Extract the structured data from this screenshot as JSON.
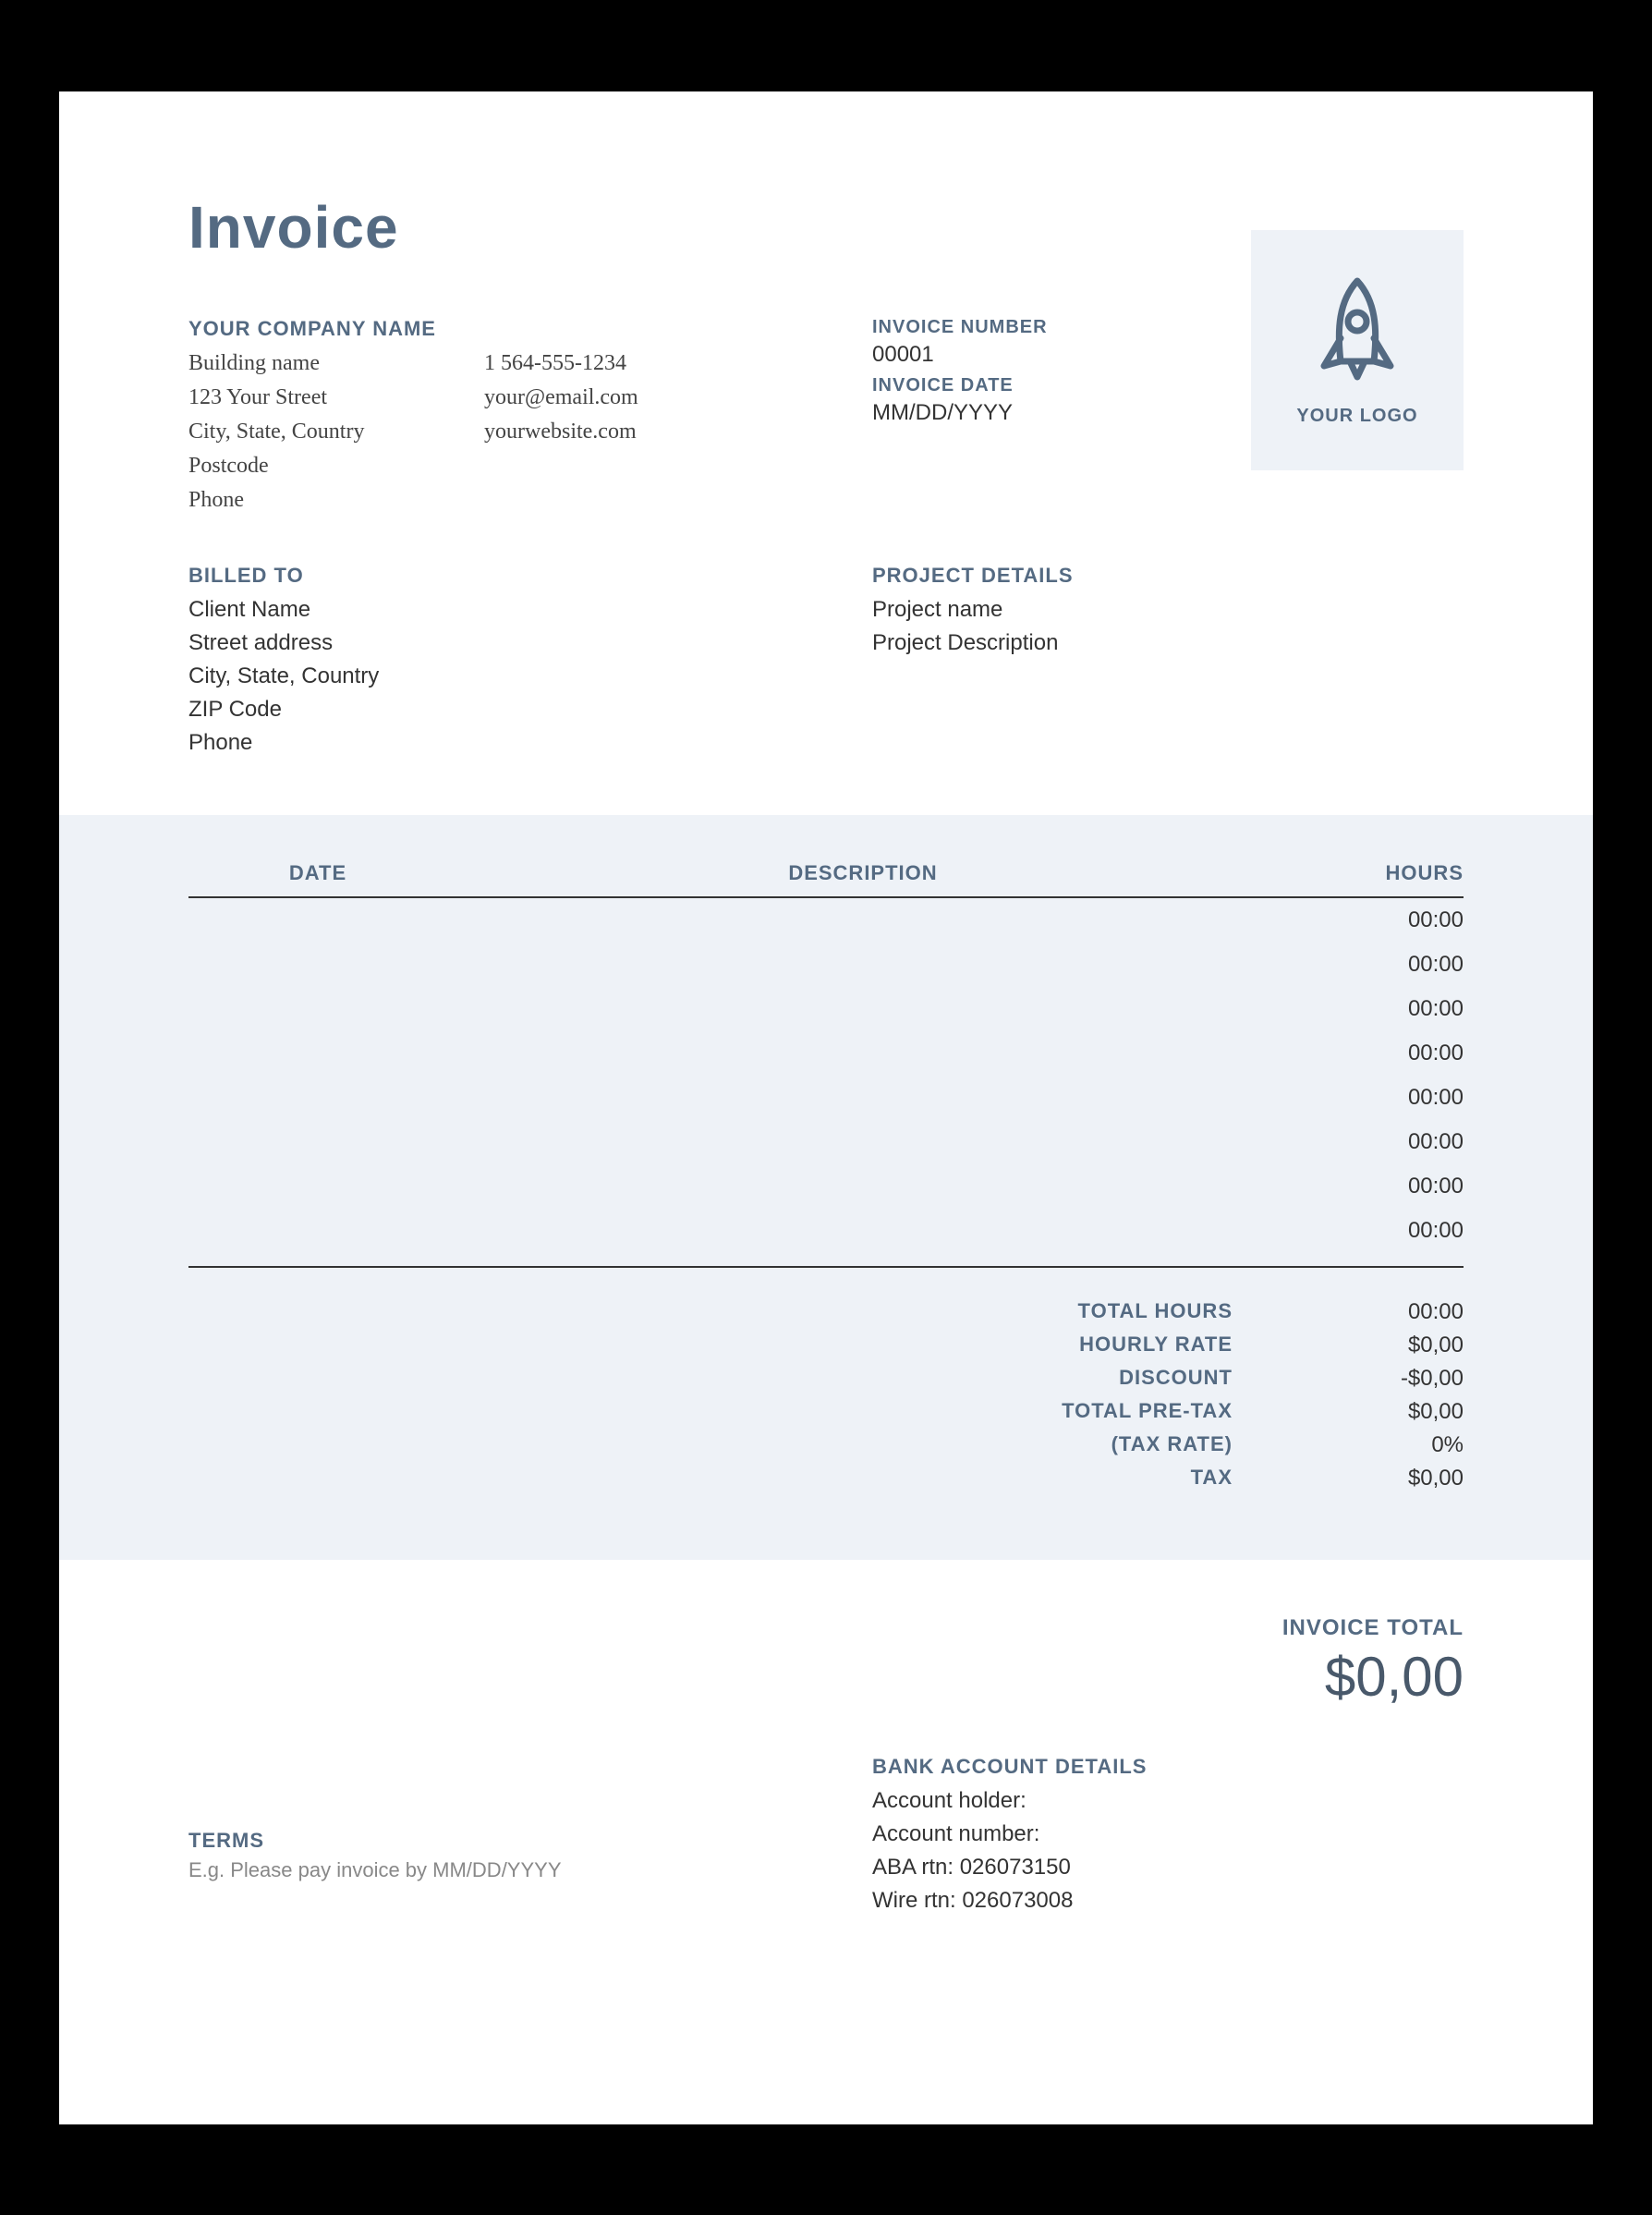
{
  "title": "Invoice",
  "company": {
    "label": "YOUR COMPANY NAME",
    "building": "Building name",
    "street": "123 Your Street",
    "city": "City, State, Country",
    "postcode": "Postcode",
    "phone_label": "Phone",
    "phone": "1 564-555-1234",
    "email": "your@email.com",
    "website": "yourwebsite.com"
  },
  "invoice_meta": {
    "number_label": "INVOICE NUMBER",
    "number": "00001",
    "date_label": "INVOICE DATE",
    "date": "MM/DD/YYYY"
  },
  "logo_caption": "YOUR LOGO",
  "billed_to": {
    "label": "BILLED TO",
    "name": "Client Name",
    "street": "Street address",
    "city": "City, State, Country",
    "zip": "ZIP Code",
    "phone": "Phone"
  },
  "project": {
    "label": "PROJECT DETAILS",
    "name": "Project name",
    "description": "Project Description"
  },
  "table": {
    "headers": {
      "date": "DATE",
      "description": "DESCRIPTION",
      "hours": "HOURS"
    },
    "rows": [
      {
        "date": "",
        "description": "",
        "hours": "00:00"
      },
      {
        "date": "",
        "description": "",
        "hours": "00:00"
      },
      {
        "date": "",
        "description": "",
        "hours": "00:00"
      },
      {
        "date": "",
        "description": "",
        "hours": "00:00"
      },
      {
        "date": "",
        "description": "",
        "hours": "00:00"
      },
      {
        "date": "",
        "description": "",
        "hours": "00:00"
      },
      {
        "date": "",
        "description": "",
        "hours": "00:00"
      },
      {
        "date": "",
        "description": "",
        "hours": "00:00"
      }
    ]
  },
  "totals": {
    "total_hours_label": "TOTAL HOURS",
    "total_hours": "00:00",
    "hourly_rate_label": "HOURLY RATE",
    "hourly_rate": "$0,00",
    "discount_label": "DISCOUNT",
    "discount": "-$0,00",
    "pretax_label": "TOTAL PRE-TAX",
    "pretax": "$0,00",
    "tax_rate_label": "(TAX RATE)",
    "tax_rate": "0%",
    "tax_label": "TAX",
    "tax": "$0,00"
  },
  "grand_total": {
    "label": "INVOICE TOTAL",
    "value": "$0,00"
  },
  "bank": {
    "label": "BANK ACCOUNT DETAILS",
    "holder": "Account holder:",
    "number": "Account number:",
    "aba": "ABA rtn: 026073150",
    "wire": "Wire rtn: 026073008"
  },
  "terms": {
    "label": "TERMS",
    "text": "E.g. Please pay invoice by MM/DD/YYYY"
  }
}
